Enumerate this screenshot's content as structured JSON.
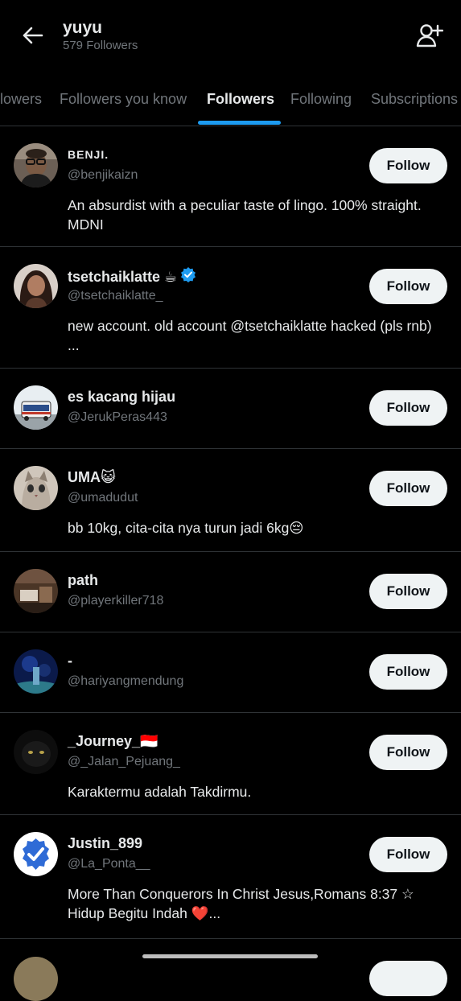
{
  "header": {
    "title": "yuyu",
    "subtitle": "579 Followers",
    "back_icon": "arrow-left-icon",
    "add_icon": "add-user-icon"
  },
  "tabs": [
    {
      "label": "Verified Followers",
      "visible_label": "lowers"
    },
    {
      "label": "Followers you know"
    },
    {
      "label": "Followers",
      "active": true
    },
    {
      "label": "Following"
    },
    {
      "label": "Subscriptions"
    }
  ],
  "follow_label": "Follow",
  "colors": {
    "background": "#000000",
    "accent": "#1d9bf0",
    "muted": "#71767b",
    "divider": "#2f3336",
    "button_bg": "#eff3f4"
  },
  "followers": [
    {
      "name": "BENJI.",
      "handle": "@benjikaizn",
      "bio": "An absurdist with a peculiar taste of lingo. 100% straight. MDNI"
    },
    {
      "name": "tsetchaiklatte ☕",
      "verified": true,
      "handle": "@tsetchaiklatte_",
      "bio": "new account. old account @tsetchaiklatte hacked (pls rnb) ..."
    },
    {
      "name": "es kacang hijau",
      "handle": "@JerukPeras443",
      "bio": ""
    },
    {
      "name": "UMA😺",
      "handle": "@umadudut",
      "bio": "bb 10kg, cita-cita nya turun jadi 6kg😔"
    },
    {
      "name": "path",
      "handle": "@playerkiller718",
      "bio": ""
    },
    {
      "name": "-",
      "handle": "@hariyangmendung",
      "bio": ""
    },
    {
      "name": "_Journey_🇮🇩",
      "handle": "@_Jalan_Pejuang_",
      "bio": "Karaktermu adalah Takdirmu."
    },
    {
      "name": "Justin_899",
      "handle": "@La_Ponta__",
      "bio": "More Than Conquerors In Christ Jesus,Romans 8:37 ☆ Hidup Begitu Indah ❤️..."
    }
  ]
}
